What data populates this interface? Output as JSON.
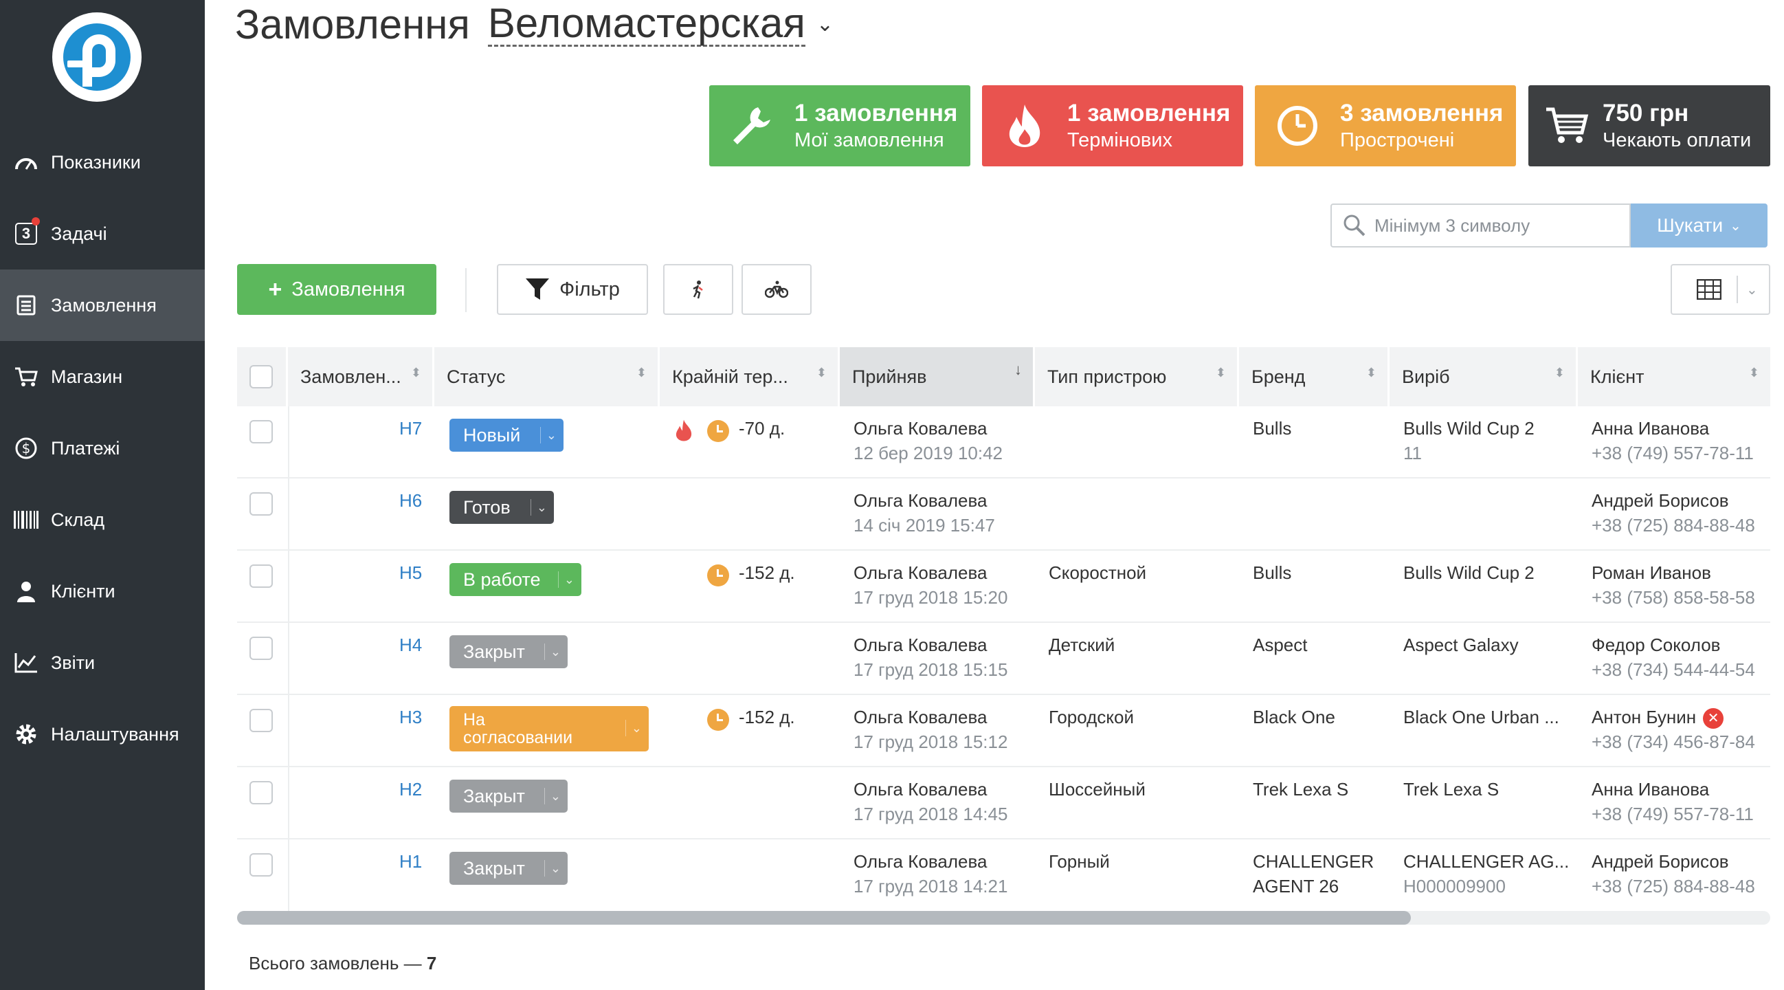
{
  "sidebar": {
    "items": [
      {
        "label": "Показники",
        "icon": "gauge-icon"
      },
      {
        "label": "Задачі",
        "icon": "calendar-badge-icon",
        "badge": "3"
      },
      {
        "label": "Замовлення",
        "icon": "orders-icon",
        "active": true
      },
      {
        "label": "Магазин",
        "icon": "cart-icon"
      },
      {
        "label": "Платежі",
        "icon": "dollar-icon"
      },
      {
        "label": "Склад",
        "icon": "barcode-icon"
      },
      {
        "label": "Клієнти",
        "icon": "user-icon"
      },
      {
        "label": "Звіти",
        "icon": "chart-icon"
      },
      {
        "label": "Налаштування",
        "icon": "gear-icon"
      }
    ]
  },
  "header": {
    "title": "Замовлення",
    "store": "Веломастерская"
  },
  "cards": [
    {
      "line1": "1 замовлення",
      "line2": "Мої замовлення",
      "color": "#5cb85c",
      "icon": "wrench-icon"
    },
    {
      "line1": "1 замовлення",
      "line2": "Термінових",
      "color": "#e9534f",
      "icon": "fire-icon"
    },
    {
      "line1": "3 замовлення",
      "line2": "Прострочені",
      "color": "#efa641",
      "icon": "clock-icon"
    },
    {
      "line1": "750 грн",
      "line2": "Чекають оплати",
      "color": "#3d3f41",
      "icon": "cart-icon"
    }
  ],
  "search": {
    "placeholder": "Мінімум 3 символу",
    "button": "Шукати"
  },
  "toolbar": {
    "add_label": "Замовлення",
    "filter_label": "Фільтр"
  },
  "table": {
    "columns": [
      "Замовлен...",
      "Статус",
      "Крайній тер...",
      "Прийняв",
      "Тип пристрою",
      "Бренд",
      "Виріб",
      "Клієнт"
    ],
    "rows": [
      {
        "id": "H7",
        "status": "Новый",
        "status_color": "#4a90d9",
        "fire": true,
        "clock": true,
        "deadline": "-70 д.",
        "taker": "Ольга Ковалева",
        "date": "12 бер 2019 10:42",
        "type": "",
        "brand": "Bulls",
        "brand2": "",
        "product": "Bulls Wild Cup 2",
        "product_sub": "11",
        "client": "Анна Иванова",
        "phone": "+38 (749) 557-78-11",
        "client_err": false
      },
      {
        "id": "H6",
        "status": "Готов",
        "status_color": "#4a4d50",
        "fire": false,
        "clock": false,
        "deadline": "",
        "taker": "Ольга Ковалева",
        "date": "14 січ 2019 15:47",
        "type": "",
        "brand": "",
        "brand2": "",
        "product": "",
        "product_sub": "",
        "client": "Андрей Борисов",
        "phone": "+38 (725) 884-88-48",
        "client_err": false
      },
      {
        "id": "H5",
        "status": "В работе",
        "status_color": "#5cb85c",
        "fire": false,
        "clock": true,
        "deadline": "-152 д.",
        "taker": "Ольга Ковалева",
        "date": "17 груд 2018 15:20",
        "type": "Скоростной",
        "brand": "Bulls",
        "brand2": "",
        "product": "Bulls Wild Cup 2",
        "product_sub": "",
        "client": "Роман Иванов",
        "phone": "+38 (758) 858-58-58",
        "client_err": false
      },
      {
        "id": "H4",
        "status": "Закрыт",
        "status_color": "#9b9ea1",
        "fire": false,
        "clock": false,
        "deadline": "",
        "taker": "Ольга Ковалева",
        "date": "17 груд 2018 15:15",
        "type": "Детский",
        "brand": "Aspect",
        "brand2": "",
        "product": "Aspect Galaxy",
        "product_sub": "",
        "client": "Федор Соколов",
        "phone": "+38 (734) 544-44-54",
        "client_err": false
      },
      {
        "id": "H3",
        "status": "На согласовании",
        "status_line1": "На",
        "status_line2": "согласовании",
        "status_color": "#efa641",
        "fire": false,
        "clock": true,
        "deadline": "-152 д.",
        "taker": "Ольга Ковалева",
        "date": "17 груд 2018 15:12",
        "type": "Городской",
        "brand": "Black One",
        "brand2": "",
        "product": "Black One Urban ...",
        "product_sub": "",
        "client": "Антон Бунин",
        "phone": "+38 (734) 456-87-84",
        "client_err": true
      },
      {
        "id": "H2",
        "status": "Закрыт",
        "status_color": "#9b9ea1",
        "fire": false,
        "clock": false,
        "deadline": "",
        "taker": "Ольга Ковалева",
        "date": "17 груд 2018 14:45",
        "type": "Шоссейный",
        "brand": "Trek Lexa S",
        "brand2": "",
        "product": "Trek Lexa S",
        "product_sub": "",
        "client": "Анна Иванова",
        "phone": "+38 (749) 557-78-11",
        "client_err": false
      },
      {
        "id": "H1",
        "status": "Закрыт",
        "status_color": "#9b9ea1",
        "fire": false,
        "clock": false,
        "deadline": "",
        "taker": "Ольга Ковалева",
        "date": "17 груд 2018 14:21",
        "type": "Горный",
        "brand": "CHALLENGER",
        "brand2": "AGENT 26",
        "product": "CHALLENGER AG...",
        "product_sub": "H000009900",
        "client": "Андрей Борисов",
        "phone": "+38 (725) 884-88-48",
        "client_err": false
      }
    ]
  },
  "footer": {
    "total_label": "Всього замовлень —",
    "total_value": "7"
  }
}
